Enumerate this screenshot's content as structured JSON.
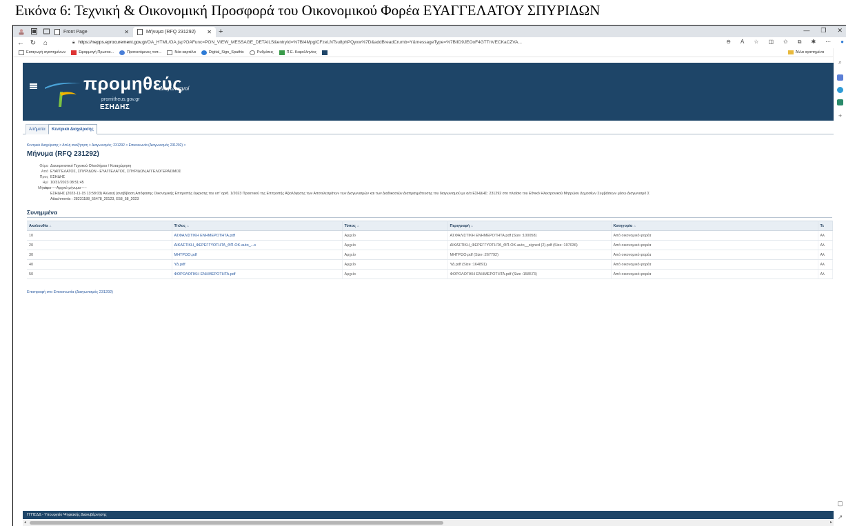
{
  "caption": "Εικόνα 6: Τεχνική & Οικονομική Προσφορά του Οικονομικού Φορέα ΕΥΑΓΓΕΛΑΤΟΥ ΣΠΥΡΙΔΩΝ",
  "browser": {
    "tabs": [
      {
        "label": "Front Page"
      },
      {
        "label": "Μήνυμα (RFQ 231292)"
      }
    ],
    "url": "https://nepps.eprocurement.gov.gr/OA_HTML/OA.jsp?OAFunc=PON_VIEW_MESSAGE_DETAILS&entryId=%7BI4MpgICFzeLNTsu8phPQyxw%7D&addBreadCrumb=Y&messageType=%7BIID9JEOoF4GTTnVECKaCZVA...",
    "url_host": "https://nepps.eprocurement.gov.gr",
    "url_rest": "/OA_HTML/OA.jsp?OAFunc=PON_VIEW_MESSAGE_DETAILS&entryId=%7BI4MpgICFzeLNTsu8phPQyxw%7D&addBreadCrumb=Y&messageType=%7BIID9JEOoF4GTTnVECKaCZVA...",
    "bookmarks": [
      "Εισαγωγή αγαπημένων",
      "Εφαρμογή Πρωτοκ...",
      "Προτεινόμενες τοπ...",
      "Νέα καρτέλα",
      "Digital_Sign_Spathis",
      "Ρυθμίσεις",
      "Π.Ε. Κεφαλληνίας"
    ],
    "other_favorites": "Άλλα αγαπημένα"
  },
  "header": {
    "logo": "προμηθεύς",
    "logo_sub": "Διαγωνισμοί",
    "logo_url": "promitheus.gov.gr",
    "logo_org": "ΕΣΗΔΗΣ"
  },
  "subtabs": [
    "Αιτήματα",
    "Κεντρικό Διαχείρισης"
  ],
  "breadcrumb": "Κεντρικό Διαχείρισης  >  Απλή αναζήτηση  >  Διαγωνισμός: 231292  >  Επικοινωνία (Διαγωνισμός 231292)  >",
  "page_title": "Μήνυμα (RFQ 231292)",
  "message": {
    "subject_label": "Θέμα",
    "subject": "Διευκρινιστικό Τεχνικού Ολοκλήρου / Καταχώρηση",
    "from_label": "Από",
    "from": "ΕΥΑΓΓΕΛΑΤΟΣ, ΣΠΥΡΙΔΩΝ - ΕΥΑΓΓΕΛΑΤΟΣ, ΣΠΥΡΙΔΩΝ,ΑΓΓΕΛΟΓΕΡΑΣΙΜΟΣ",
    "to_label": "Προς",
    "to": "ΕΣΗΔΗΣ",
    "date_label": "Ημ/νία",
    "date": "10/31/2023 08:51:45",
    "body_label": "Μήνυμα",
    "body_line1": "-----Αρχικό μήνυμα-----",
    "body_line2": "ΕΣΗΔΗΣ (2023-11-15 13:58:03) Αλλαγή (αναβίβαση Απόφασης Οικονομικής Επιτροπής έγκρισης του υπ' αριθ. 1/2023 Πρακτικού της Επιτροπής Αξιολόγησης των Αποτελεσμάτων των Διαγωνισμών και των Διαδικασιών Διαπραγμάτευσης του διαγωνισμού με α/α ΕΣΗΔΗΣ: 231292 στο πλαίσιο του Εθνικό Ηλεκτρονικού Μητρώου Δημοσίων Συμβάσεων μέσω Διαγωνισμό Σ",
    "body_line3": "Attachments : 28231188_55478_20123, E58_58_2023"
  },
  "attachments": {
    "title": "Συνημμένα",
    "columns": [
      "Ακολουθία",
      "Τίτλος",
      "Τύπος",
      "Περιγραφή",
      "Κατηγορία",
      "Τε"
    ],
    "rows": [
      {
        "seq": "10",
        "title": "ΑΣΦΑΛΙΣΤΙΚΗ ΕΝΗΜΕΡΟΤΗΤΑ.pdf",
        "type": "Αρχείο",
        "desc": "ΑΣΦΑΛΙΣΤΙΚΗ ΕΝΗΜΕΡΟΤΗΤΑ.pdf (Size :100058)",
        "cat": "Από οικονομικό φορέα",
        "extra": "Αλ"
      },
      {
        "seq": "20",
        "title": "ΔΙΚΑΣΤΙΚΗ_ΦΕΡΕΓΓΥΟΤΗΤΑ_ΘΠ-ΟΚ-auto_...s",
        "type": "Αρχείο",
        "desc": "ΔΙΚΑΣΤΙΚΗ_ΦΕΡΕΓΓΥΟΤΗΤΑ_ΘΠ-ΟΚ-auto__signed (2).pdf (Size :197036)",
        "cat": "Από οικονομικό φορέα",
        "extra": "Αλ"
      },
      {
        "seq": "30",
        "title": "ΜΗΤΡΩΟ.pdf",
        "type": "Αρχείο",
        "desc": "ΜΗΤΡΩΟ.pdf (Size :267792)",
        "cat": "Από οικονομικό φορέα",
        "extra": "Αλ"
      },
      {
        "seq": "40",
        "title": "ΥΔ.pdf",
        "type": "Αρχείο",
        "desc": "ΥΔ.pdf (Size :164891)",
        "cat": "Από οικονομικό φορέα",
        "extra": "Αλ"
      },
      {
        "seq": "50",
        "title": "ΦΟΡΟΛΟΓΙΚΗ ΕΝΗΜΕΡΟΤΗΤΑ.pdf",
        "type": "Αρχείο",
        "desc": "ΦΟΡΟΛΟΓΙΚΗ ΕΝΗΜΕΡΟΤΗΤΑ.pdf (Size :158573)",
        "cat": "Από οικονομικό φορέα",
        "extra": "Αλ"
      }
    ]
  },
  "back_link": "Επιστροφή στο Επικοινωνία (Διαγωνισμός 231292)",
  "footer": "ΓΓΠΣΔΔ - Υπουργείο Ψηφιακής Διακυβέρνησης",
  "colors": {
    "header_bg": "#1e4568",
    "link": "#2a5aa0",
    "title": "#1d3b5a"
  }
}
